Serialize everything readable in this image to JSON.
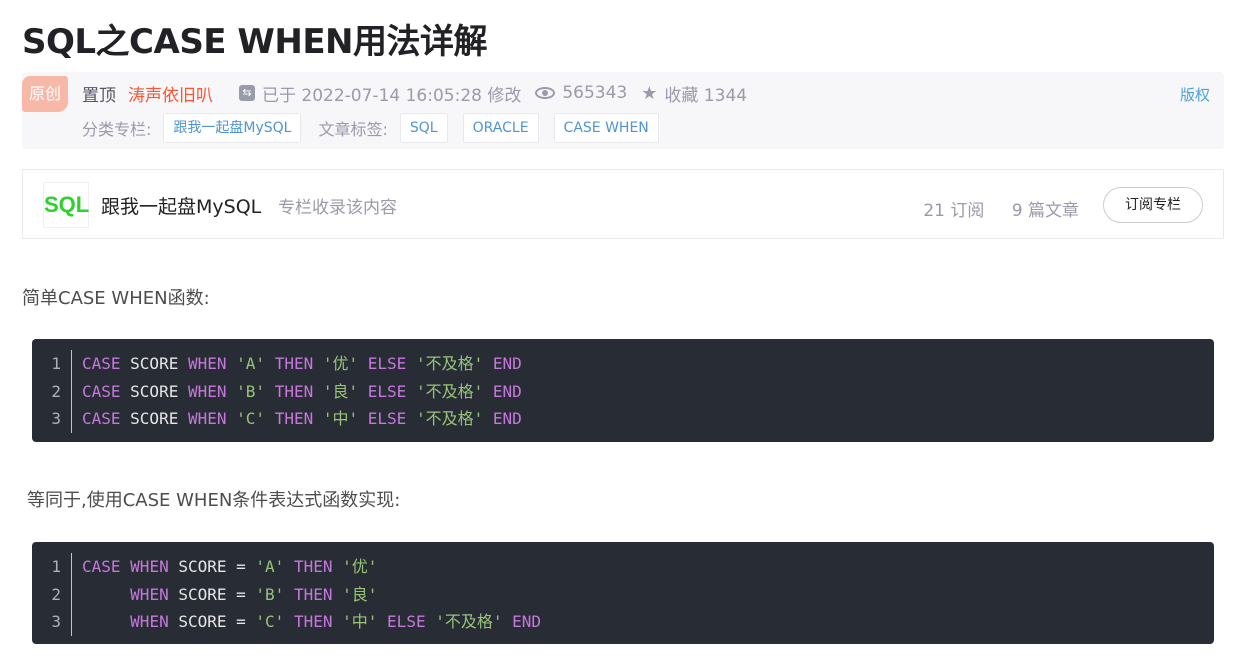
{
  "article": {
    "title": "SQL之CASE WHEN用法详解"
  },
  "meta": {
    "badge": "原创",
    "pin_label": "置顶",
    "author": "涛声依旧叭",
    "updated_text": "已于 2022-07-14 16:05:28 修改",
    "views": "565343",
    "favorites_text": "收藏 1344",
    "copyright": "版权",
    "category_label": "分类专栏:",
    "category": "跟我一起盘MySQL",
    "tags_label": "文章标签:",
    "tags": [
      "SQL",
      "ORACLE",
      "CASE WHEN"
    ]
  },
  "column": {
    "logo_text": "SQL",
    "name": "跟我一起盘MySQL",
    "desc": "专栏收录该内容",
    "subscribers": "21 订阅",
    "articles": "9 篇文章",
    "subscribe_button": "订阅专栏"
  },
  "content": {
    "para1": "简单CASE WHEN函数:",
    "code1": {
      "line_numbers": [
        "1",
        "2",
        "3"
      ],
      "lines": [
        [
          "CASE",
          " SCORE ",
          "WHEN",
          " ",
          "'A'",
          " ",
          "THEN",
          " ",
          "'优'",
          " ",
          "ELSE",
          " ",
          "'不及格'",
          " ",
          "END"
        ],
        [
          "CASE",
          " SCORE ",
          "WHEN",
          " ",
          "'B'",
          " ",
          "THEN",
          " ",
          "'良'",
          " ",
          "ELSE",
          " ",
          "'不及格'",
          " ",
          "END"
        ],
        [
          "CASE",
          " SCORE ",
          "WHEN",
          " ",
          "'C'",
          " ",
          "THEN",
          " ",
          "'中'",
          " ",
          "ELSE",
          " ",
          "'不及格'",
          " ",
          "END"
        ]
      ]
    },
    "para2": "等同于,使用CASE WHEN条件表达式函数实现:",
    "code2": {
      "line_numbers": [
        "1",
        "2",
        "3"
      ],
      "line1": [
        "CASE",
        " ",
        "WHEN",
        " SCORE = ",
        "'A'",
        " ",
        "THEN",
        " ",
        "'优'"
      ],
      "line2": [
        "     ",
        "WHEN",
        " SCORE = ",
        "'B'",
        " ",
        "THEN",
        " ",
        "'良'"
      ],
      "line3": [
        "     ",
        "WHEN",
        " SCORE = ",
        "'C'",
        " ",
        "THEN",
        " ",
        "'中'",
        " ",
        "ELSE",
        " ",
        "'不及格'",
        " ",
        "END"
      ]
    }
  },
  "icons": {
    "update": "update-icon",
    "views": "eye-icon",
    "favorites": "star-icon"
  },
  "colors": {
    "author": "#fc5531",
    "link": "#5094d5",
    "code_bg": "#282c34",
    "keyword": "#c678dd",
    "string": "#98c379",
    "logo": "#2ed12e"
  }
}
